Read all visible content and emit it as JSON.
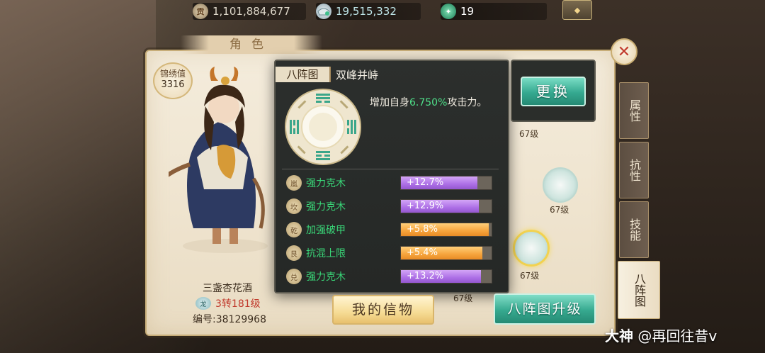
{
  "resources": {
    "gold": {
      "icon": "gong-currency-icon",
      "icon_glyph": "贡",
      "value": "1,101,884,677"
    },
    "silver": {
      "icon": "silver-ingot-icon",
      "value": "19,515,332"
    },
    "jade": {
      "icon": "jade-icon",
      "value": "19"
    }
  },
  "panel": {
    "title": "角色",
    "close_icon": "close-icon"
  },
  "side_tabs": [
    {
      "label": "属性",
      "active": false
    },
    {
      "label": "抗性",
      "active": false
    },
    {
      "label": "技能",
      "active": false
    },
    {
      "label": "八阵图",
      "active": true
    }
  ],
  "character": {
    "score_label": "锦绣值",
    "score_value": "3316",
    "name": "三盏杏花酒",
    "level_tag": "龙",
    "level": "3转181级",
    "id_text": "编号:38129968"
  },
  "formation": {
    "tag": "八阵图",
    "name": "双峰并峙",
    "desc_prefix": "增加自身",
    "desc_highlight": "6.750%",
    "desc_suffix": "攻击力。",
    "stats": [
      {
        "icon": "嵐",
        "label": "强力克木",
        "value": "+12.7%",
        "fill": 0.84,
        "color": "purple"
      },
      {
        "icon": "坎",
        "label": "强力克木",
        "value": "+12.9%",
        "fill": 0.86,
        "color": "purple"
      },
      {
        "icon": "乾",
        "label": "加强破甲",
        "value": "+5.8%",
        "fill": 0.97,
        "color": "orange"
      },
      {
        "icon": "艮",
        "label": "抗混上限",
        "value": "+5.4%",
        "fill": 0.9,
        "color": "orange"
      },
      {
        "icon": "兑",
        "label": "强力克木",
        "value": "+13.2%",
        "fill": 0.88,
        "color": "purple"
      }
    ]
  },
  "buttons": {
    "change": "更换",
    "trust": "我的信物",
    "upgrade": "八阵图升级"
  },
  "slots": [
    {
      "level": "67级"
    },
    {
      "level": "67级"
    },
    {
      "level": "67级"
    },
    {
      "level": "67级"
    }
  ],
  "watermark": {
    "brand": "大神",
    "handle": "@再回往昔v"
  }
}
